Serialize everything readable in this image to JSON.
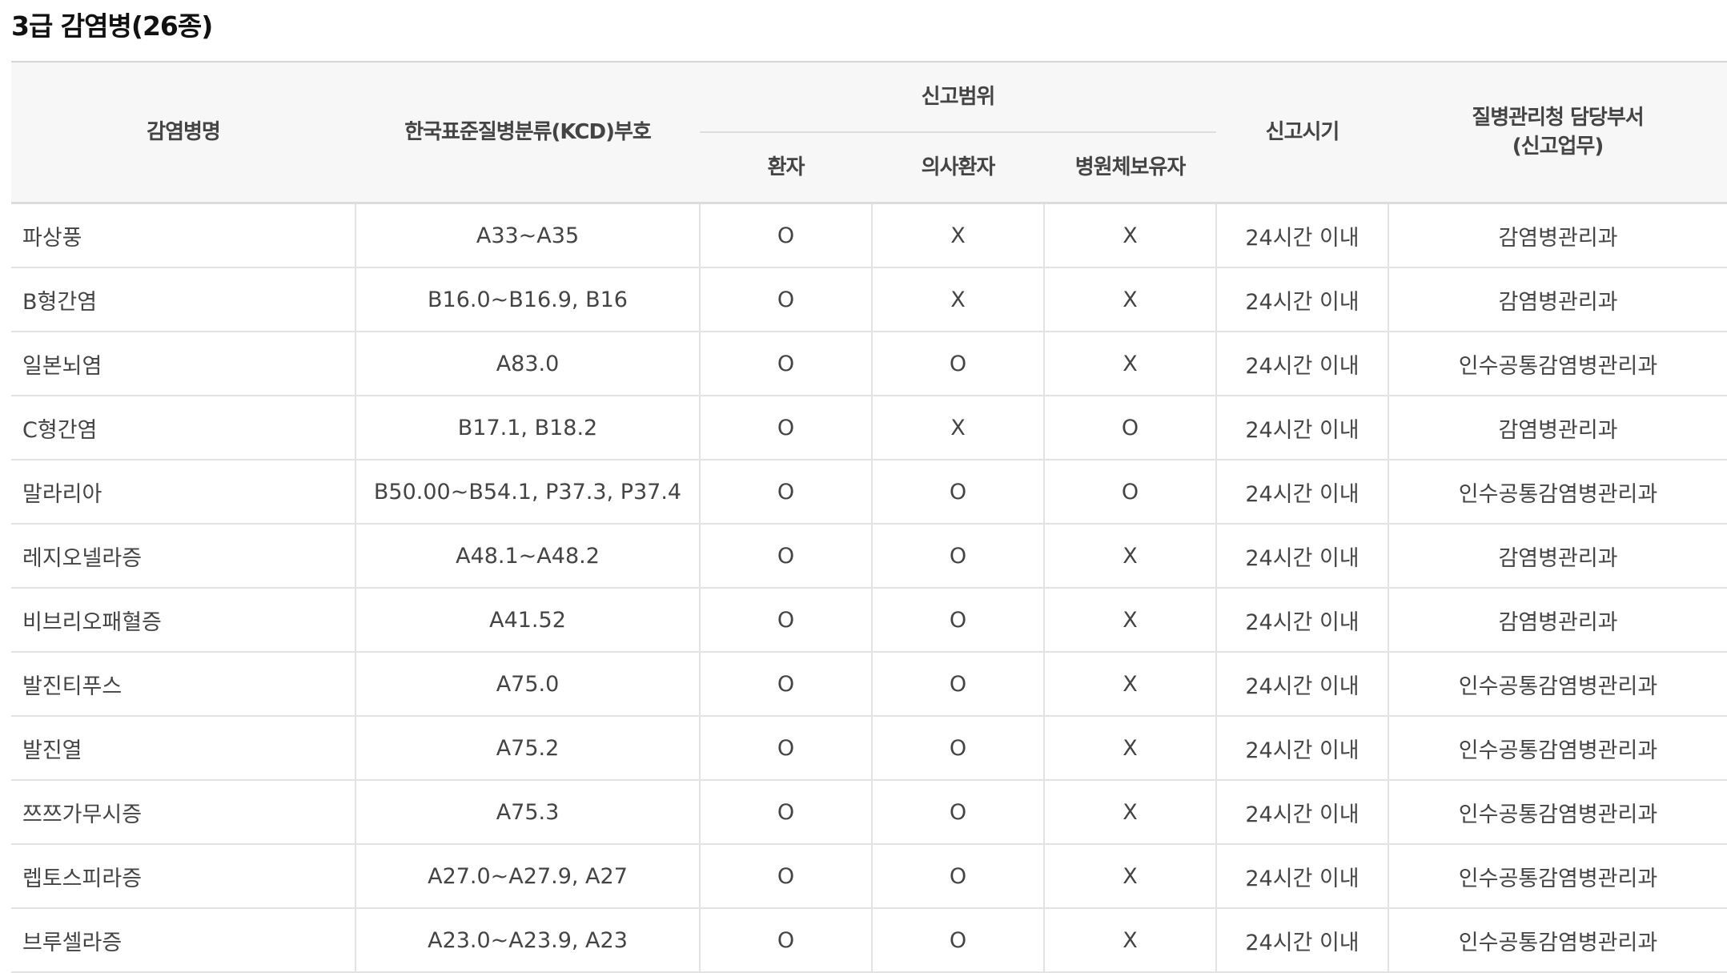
{
  "page": {
    "title": "3급 감염병(26종)"
  },
  "table": {
    "headers": {
      "disease_name": "감염병명",
      "kcd_code": "한국표준질병분류(KCD)부호",
      "report_scope": "신고범위",
      "patient": "환자",
      "suspected_patient": "의사환자",
      "pathogen_carrier": "병원체보유자",
      "report_time": "신고시기",
      "department_line1": "질병관리청 담당부서",
      "department_line2": "(신고업무)"
    },
    "rows": [
      {
        "name": "파상풍",
        "code": "A33~A35",
        "patient": "O",
        "suspected": "X",
        "carrier": "X",
        "time": "24시간 이내",
        "dept": "감염병관리과"
      },
      {
        "name": "B형간염",
        "code": "B16.0~B16.9, B16",
        "patient": "O",
        "suspected": "X",
        "carrier": "X",
        "time": "24시간 이내",
        "dept": "감염병관리과"
      },
      {
        "name": "일본뇌염",
        "code": "A83.0",
        "patient": "O",
        "suspected": "O",
        "carrier": "X",
        "time": "24시간 이내",
        "dept": "인수공통감염병관리과"
      },
      {
        "name": "C형간염",
        "code": "B17.1, B18.2",
        "patient": "O",
        "suspected": "X",
        "carrier": "O",
        "time": "24시간 이내",
        "dept": "감염병관리과"
      },
      {
        "name": "말라리아",
        "code": "B50.00~B54.1, P37.3, P37.4",
        "patient": "O",
        "suspected": "O",
        "carrier": "O",
        "time": "24시간 이내",
        "dept": "인수공통감염병관리과"
      },
      {
        "name": "레지오넬라증",
        "code": "A48.1~A48.2",
        "patient": "O",
        "suspected": "O",
        "carrier": "X",
        "time": "24시간 이내",
        "dept": "감염병관리과"
      },
      {
        "name": "비브리오패혈증",
        "code": "A41.52",
        "patient": "O",
        "suspected": "O",
        "carrier": "X",
        "time": "24시간 이내",
        "dept": "감염병관리과"
      },
      {
        "name": "발진티푸스",
        "code": "A75.0",
        "patient": "O",
        "suspected": "O",
        "carrier": "X",
        "time": "24시간 이내",
        "dept": "인수공통감염병관리과"
      },
      {
        "name": "발진열",
        "code": "A75.2",
        "patient": "O",
        "suspected": "O",
        "carrier": "X",
        "time": "24시간 이내",
        "dept": "인수공통감염병관리과"
      },
      {
        "name": "쯔쯔가무시증",
        "code": "A75.3",
        "patient": "O",
        "suspected": "O",
        "carrier": "X",
        "time": "24시간 이내",
        "dept": "인수공통감염병관리과"
      },
      {
        "name": "렙토스피라증",
        "code": "A27.0~A27.9, A27",
        "patient": "O",
        "suspected": "O",
        "carrier": "X",
        "time": "24시간 이내",
        "dept": "인수공통감염병관리과"
      },
      {
        "name": "브루셀라증",
        "code": "A23.0~A23.9, A23",
        "patient": "O",
        "suspected": "O",
        "carrier": "X",
        "time": "24시간 이내",
        "dept": "인수공통감염병관리과"
      }
    ]
  }
}
